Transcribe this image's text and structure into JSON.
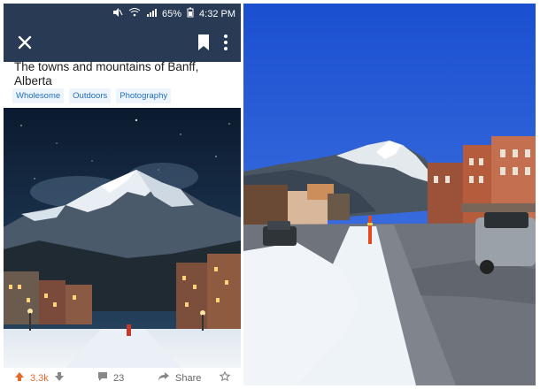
{
  "status": {
    "battery": "65%",
    "time": "4:32 PM"
  },
  "post": {
    "title": "The towns and mountains of Banff, Alberta",
    "tags": [
      "Wholesome",
      "Outdoors",
      "Photography"
    ]
  },
  "actions": {
    "upvotes": "3.3k",
    "comments": "23",
    "share_label": "Share"
  },
  "colors": {
    "app_bar": "#283a54",
    "tag_text": "#1f6fbf",
    "upvote": "#e36a2b"
  },
  "icons": [
    "close-icon",
    "bookmark-icon",
    "more-icon",
    "upvote-icon",
    "downvote-icon",
    "comment-icon",
    "share-icon",
    "award-icon"
  ]
}
